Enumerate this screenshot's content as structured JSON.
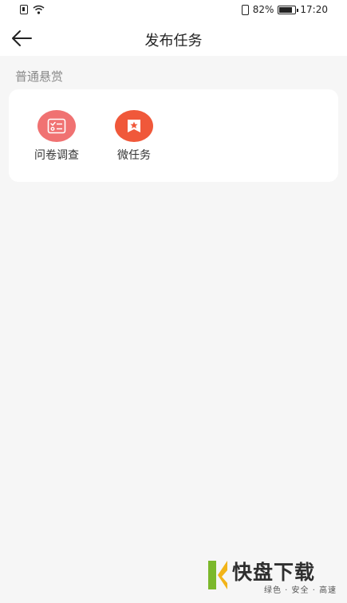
{
  "status_bar": {
    "battery": "82%",
    "time": "17:20",
    "icons": [
      "sim-icon",
      "wifi-icon",
      "vibrate-icon",
      "battery-icon"
    ]
  },
  "nav": {
    "title": "发布任务",
    "back_icon": "arrow-left-icon"
  },
  "section": {
    "title": "普通悬赏"
  },
  "tasks": [
    {
      "label": "问卷调查",
      "icon": "survey-checklist-icon",
      "color": "#f07272"
    },
    {
      "label": "微任务",
      "icon": "star-bookmark-icon",
      "color": "#f0583a"
    }
  ],
  "watermark": {
    "title": "快盘下载",
    "subtitle": "绿色 · 安全 · 高速"
  },
  "colors": {
    "background": "#f6f6f6",
    "card": "#ffffff",
    "brand_green": "#7bb82b"
  }
}
